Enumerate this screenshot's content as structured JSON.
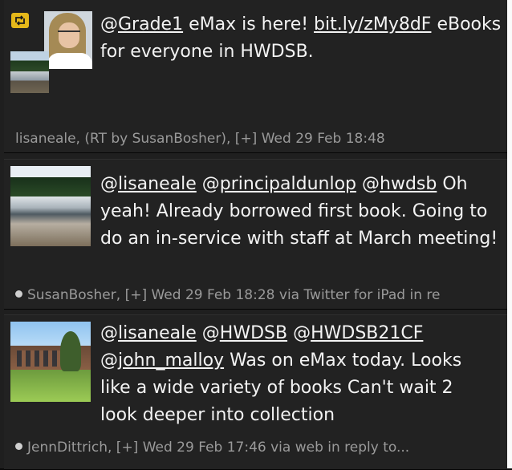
{
  "tweets": [
    {
      "id": "t1",
      "retweeted": true,
      "lines": [
        {
          "parts": [
            {
              "text": "@",
              "link": false
            },
            {
              "text": "Grade1",
              "link": true
            },
            {
              "text": " eMax is here! ",
              "link": false
            },
            {
              "text": "bit.ly/zMy8dF",
              "link": true
            },
            {
              "text": " eBooks",
              "link": false
            }
          ]
        },
        {
          "parts": [
            {
              "text": "for everyone in HWDSB.",
              "link": false
            }
          ]
        }
      ],
      "meta": "lisaneale, (RT by SusanBosher), [+] Wed 29 Feb 18:48",
      "has_dot": false
    },
    {
      "id": "t2",
      "retweeted": false,
      "lines": [
        {
          "parts": [
            {
              "text": "@",
              "link": false
            },
            {
              "text": "lisaneale",
              "link": true
            },
            {
              "text": " @",
              "link": false
            },
            {
              "text": "principaldunlop",
              "link": true
            },
            {
              "text": " @",
              "link": false
            },
            {
              "text": "hwdsb",
              "link": true
            },
            {
              "text": " Oh",
              "link": false
            }
          ]
        },
        {
          "parts": [
            {
              "text": "yeah! Already borrowed first book. Going to",
              "link": false
            }
          ]
        },
        {
          "parts": [
            {
              "text": "do an in-service with staff at March meeting!",
              "link": false
            }
          ]
        }
      ],
      "meta": "SusanBosher, [+] Wed 29 Feb 18:28 via Twitter for iPad in re",
      "has_dot": true
    },
    {
      "id": "t3",
      "retweeted": false,
      "lines": [
        {
          "parts": [
            {
              "text": "@",
              "link": false
            },
            {
              "text": "lisaneale",
              "link": true
            },
            {
              "text": " @",
              "link": false
            },
            {
              "text": "HWDSB",
              "link": true
            },
            {
              "text": "  @",
              "link": false
            },
            {
              "text": "HWDSB21CF",
              "link": true
            }
          ]
        },
        {
          "parts": [
            {
              "text": "@",
              "link": false
            },
            {
              "text": "john_malloy",
              "link": true
            },
            {
              "text": " Was on eMax today. Looks",
              "link": false
            }
          ]
        },
        {
          "parts": [
            {
              "text": "like a wide variety of books Can't wait 2",
              "link": false
            }
          ]
        },
        {
          "parts": [
            {
              "text": "look deeper into collection",
              "link": false
            }
          ]
        }
      ],
      "meta": "JennDittrich, [+] Wed 29 Feb 17:46 via web  in reply to...",
      "has_dot": true
    }
  ],
  "icons": {
    "retweet": "retweet-icon"
  },
  "colors": {
    "background": "#222222",
    "text": "#f3f3f3",
    "meta_text": "#9a9a9a",
    "retweet_badge": "#e5b81a"
  }
}
